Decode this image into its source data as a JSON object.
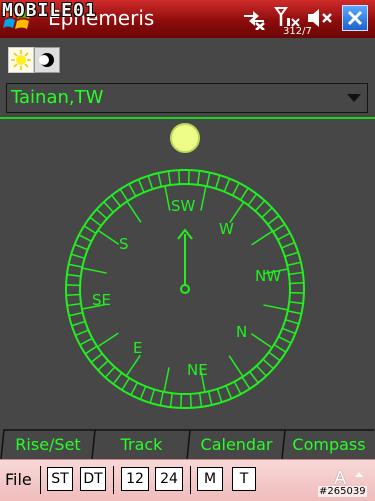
{
  "window": {
    "title": "Ephemeris",
    "watermark": "MOBILE01",
    "status_text": "312/7",
    "icons": [
      "start-menu-icon",
      "connectivity-icon",
      "signal-icon",
      "volume-muted-icon",
      "close-icon"
    ]
  },
  "mode_toggles": [
    {
      "name": "sun-icon"
    },
    {
      "name": "moon-icon"
    }
  ],
  "location": {
    "value": "Tainan,TW"
  },
  "compass": {
    "directions": [
      "SW",
      "W",
      "NW",
      "N",
      "NE",
      "E",
      "SE",
      "S"
    ],
    "colors": {
      "ring": "#22ee22",
      "sun": "#eefc88",
      "background": "#474747"
    }
  },
  "tabs": [
    "Rise/Set",
    "Track",
    "Calendar",
    "Compass"
  ],
  "active_tab": "Compass",
  "toolbar": {
    "file": "File",
    "buttons": [
      "ST",
      "DT",
      "12",
      "24",
      "M",
      "T"
    ],
    "input_indicator": "A"
  },
  "image_id": "#265039"
}
